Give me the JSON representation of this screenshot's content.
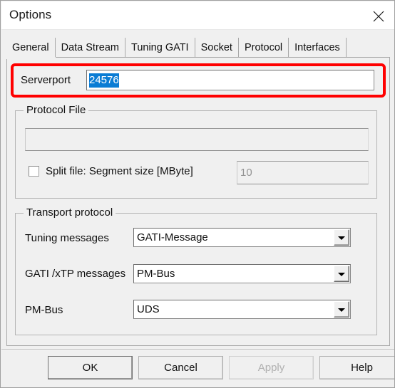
{
  "window": {
    "title": "Options",
    "close_icon": "close-icon"
  },
  "tabs": [
    {
      "label": "General",
      "selected": true
    },
    {
      "label": "Data Stream",
      "selected": false
    },
    {
      "label": "Tuning GATI",
      "selected": false
    },
    {
      "label": "Socket",
      "selected": false
    },
    {
      "label": "Protocol",
      "selected": false
    },
    {
      "label": "Interfaces",
      "selected": false
    }
  ],
  "serverport": {
    "label": "Serverport",
    "value": "24576",
    "selected": true,
    "selection_color": "#0a7cd4",
    "highlight_color": "#ff0000"
  },
  "protocol_file": {
    "group_title": "Protocol File",
    "path_value": "",
    "path_placeholder": "",
    "path_enabled": false,
    "split_file": {
      "label": "Split file: Segment size [MByte]",
      "checked": false
    },
    "segment_size": {
      "value": "10",
      "enabled": false
    }
  },
  "transport_protocol": {
    "group_title": "Transport protocol",
    "rows": [
      {
        "label": "Tuning messages",
        "value": "GATI-Message"
      },
      {
        "label": "GATI /xTP messages",
        "value": "PM-Bus"
      },
      {
        "label": "PM-Bus",
        "value": "UDS"
      }
    ]
  },
  "buttons": [
    {
      "label": "OK",
      "state": "default"
    },
    {
      "label": "Cancel",
      "state": "normal"
    },
    {
      "label": "Apply",
      "state": "disabled"
    },
    {
      "label": "Help",
      "state": "normal"
    }
  ]
}
